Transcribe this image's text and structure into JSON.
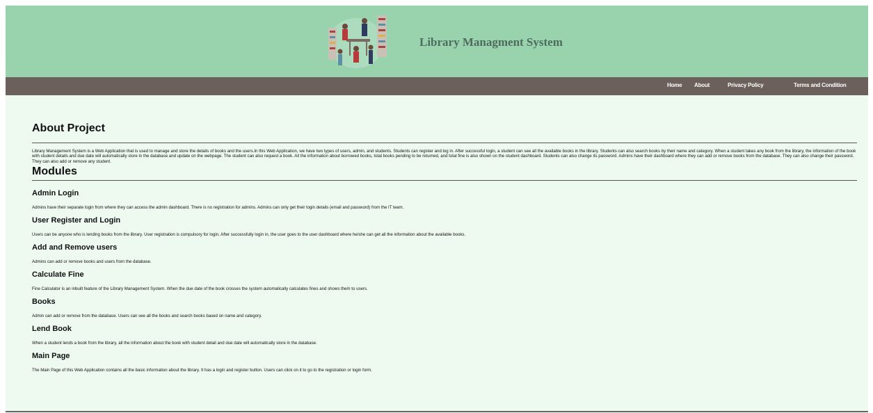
{
  "header": {
    "title": "Library Managment System",
    "logo_icon": "library-illustration-icon"
  },
  "nav": {
    "items": [
      {
        "label": "Home"
      },
      {
        "label": "About"
      },
      {
        "label": "Privacy Policy"
      },
      {
        "label": "Terms and Condition"
      }
    ]
  },
  "about": {
    "heading": "About Project",
    "text": "Library Management System is a Web Application that is used to manage and store the details of books and the users.In this Web Application, we have two types of users, admin, and students. Students can register and log in. After successful login, a student can see all the available books in the library. Students can also search books by their name and category. When a student takes any book from the library, the information of the book with student details and due date will automatically store in the database and update on the webpage. The student can also request a book. All the information about borrowed books, total books pending to be returned, and total fine is also shown on the student dashboard. Students can also change its password. Admins have their dashboard where they can add or remove books from the database. They can also change their password. They can also add or remove any student."
  },
  "modules": {
    "heading": "Modules",
    "items": [
      {
        "title": "Admin Login",
        "desc": "Admins have their separate login from where they can access the admin dashboard. There is no registration for admins. Admins can only get their login details (email and password) from the IT team."
      },
      {
        "title": "User Register and Login",
        "desc": "Users can be anyone who is lending books from the library. User registration is compulsory for login. After successfully login in, the user goes to the user dashboard where he/she can get all the information about the available books."
      },
      {
        "title": "Add and Remove users",
        "desc": "Admins can add or remove books and users from the database."
      },
      {
        "title": "Calculate Fine",
        "desc": "Fine Calculator is an inbuilt feature of the Library Management System. When the due date of the book crosses the system automatically calculates fines and shows them to users."
      },
      {
        "title": "Books",
        "desc": "Admin can add or remove from the database. Users can see all the books and search books based on name and category."
      },
      {
        "title": "Lend Book",
        "desc": "When a student lends a book from the library, all the information about the book with student detail and due date will automatically store in the database."
      },
      {
        "title": "Main Page",
        "desc": "The Main Page of this Web Application contains all the basic information about the library. It has a login and register button. Users can click on it to go to the registration or login form."
      }
    ]
  },
  "colors": {
    "header_bg": "#98d3ae",
    "nav_bg": "#6b605c",
    "page_bg": "#eef9ef",
    "title_color": "#4e6b5e"
  }
}
